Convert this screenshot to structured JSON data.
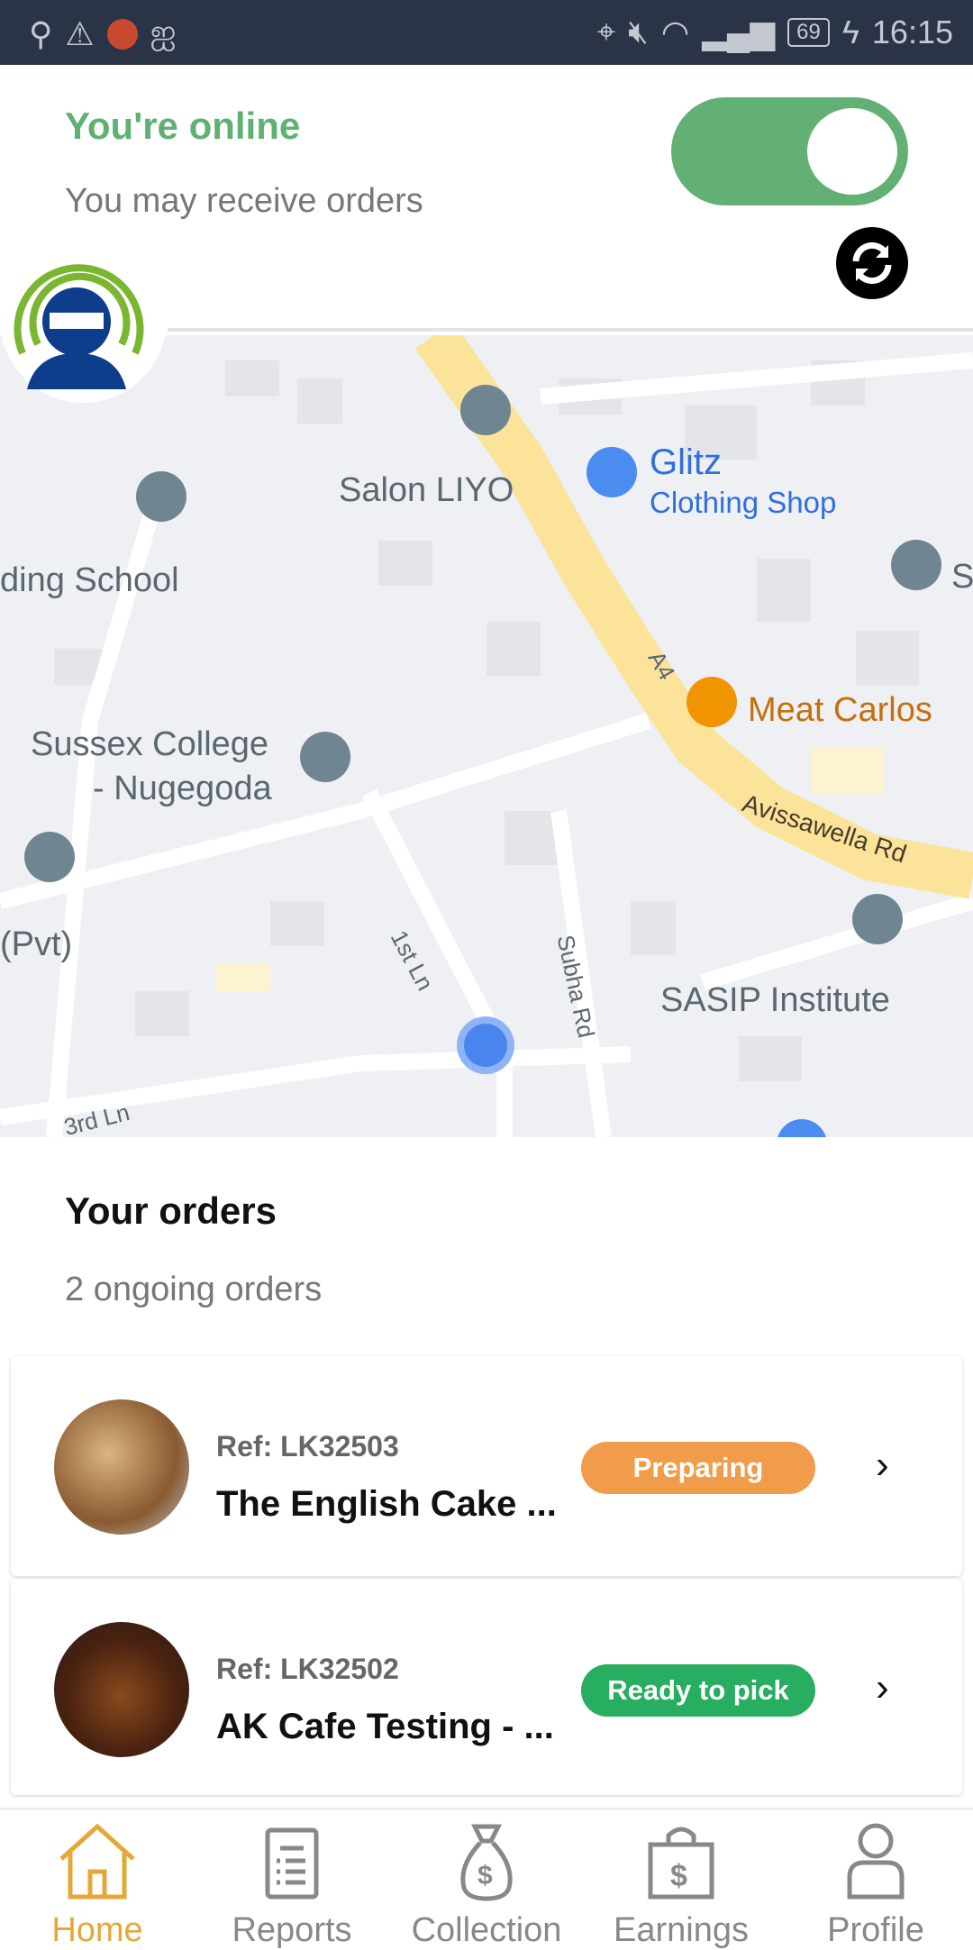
{
  "status_bar": {
    "time": "16:15",
    "battery": "69"
  },
  "header": {
    "status_title": "You're online",
    "status_subtitle": "You may receive orders",
    "online_toggle": true
  },
  "map": {
    "labels": {
      "salon": "Salon LIYO",
      "glitz": "Glitz",
      "glitz_sub": "Clothing Shop",
      "school": "ding School",
      "church": "S",
      "highway": "A4",
      "meat": "Meat Carlos",
      "sussex1": "Sussex College",
      "sussex2": "- Nugegoda",
      "pvt": "(Pvt)",
      "avissawella": "Avissawella Rd",
      "sasip": "SASIP Institute",
      "first_ln": "1st Ln",
      "subha": "Subha Rd",
      "third_ln": "3rd Ln"
    }
  },
  "orders": {
    "title": "Your orders",
    "count_text": "2 ongoing orders",
    "items": [
      {
        "ref": "Ref: LK32503",
        "name": "The English Cake ...",
        "status": "Preparing",
        "status_color": "#f09c4b"
      },
      {
        "ref": "Ref: LK32502",
        "name": "AK Cafe Testing - ...",
        "status": "Ready to pick",
        "status_color": "#27ae60"
      }
    ]
  },
  "nav": {
    "items": [
      {
        "label": "Home",
        "icon": "home-icon",
        "active": true
      },
      {
        "label": "Reports",
        "icon": "clipboard-icon"
      },
      {
        "label": "Collection",
        "icon": "money-bag-icon"
      },
      {
        "label": "Earnings",
        "icon": "money-bag-dollar-icon"
      },
      {
        "label": "Profile",
        "icon": "user-icon"
      }
    ]
  },
  "colors": {
    "accent_green": "#5fb173",
    "active_nav": "#e5a838",
    "status_bar": "#2b3346"
  }
}
